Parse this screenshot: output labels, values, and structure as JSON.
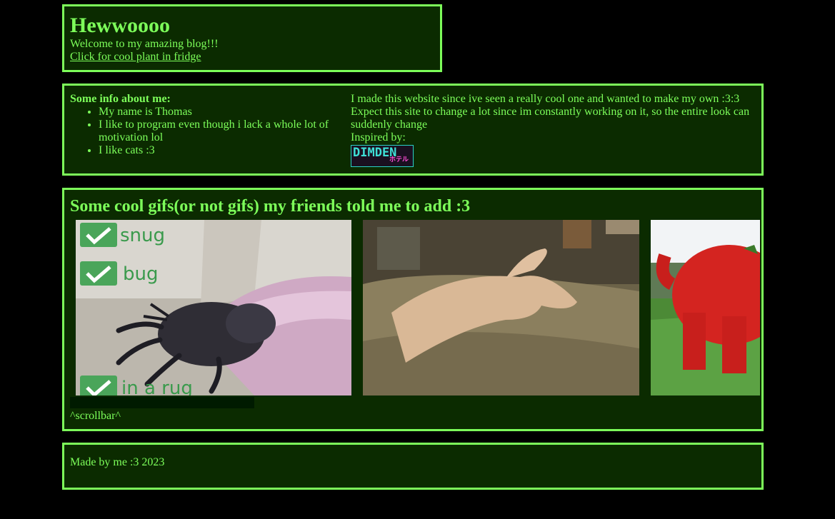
{
  "header": {
    "title": "Hewwoooo",
    "welcome": "Welcome to my amazing blog!!!",
    "link": "Click for cool plant in fridge"
  },
  "info": {
    "heading": "Some info about me:",
    "items": [
      "My name is Thomas",
      "I like to program even though i lack a whole lot of motivation lol",
      "I like cats :3"
    ],
    "right_line1": "I made this website since ive seen a really cool one and wanted to make my own :3:3",
    "right_line2": "Expect this site to change a lot since im constantly working on it, so the entire look can suddenly change",
    "inspired_by": "Inspired by:",
    "badge_text": "DIMDEN",
    "badge_sub": "ホテル"
  },
  "gifs": {
    "heading": "Some cool gifs(or not gifs) my friends told me to add :3",
    "tile1": {
      "line1": "snug",
      "line2": "bug",
      "line3": "in a rug"
    },
    "scroll_note": "^scrollbar^"
  },
  "footer": {
    "text": "Made by me :3 2023"
  },
  "colors": {
    "accent": "#7dff5a",
    "panel_bg": "#0b2b00",
    "page_bg": "#000000"
  }
}
